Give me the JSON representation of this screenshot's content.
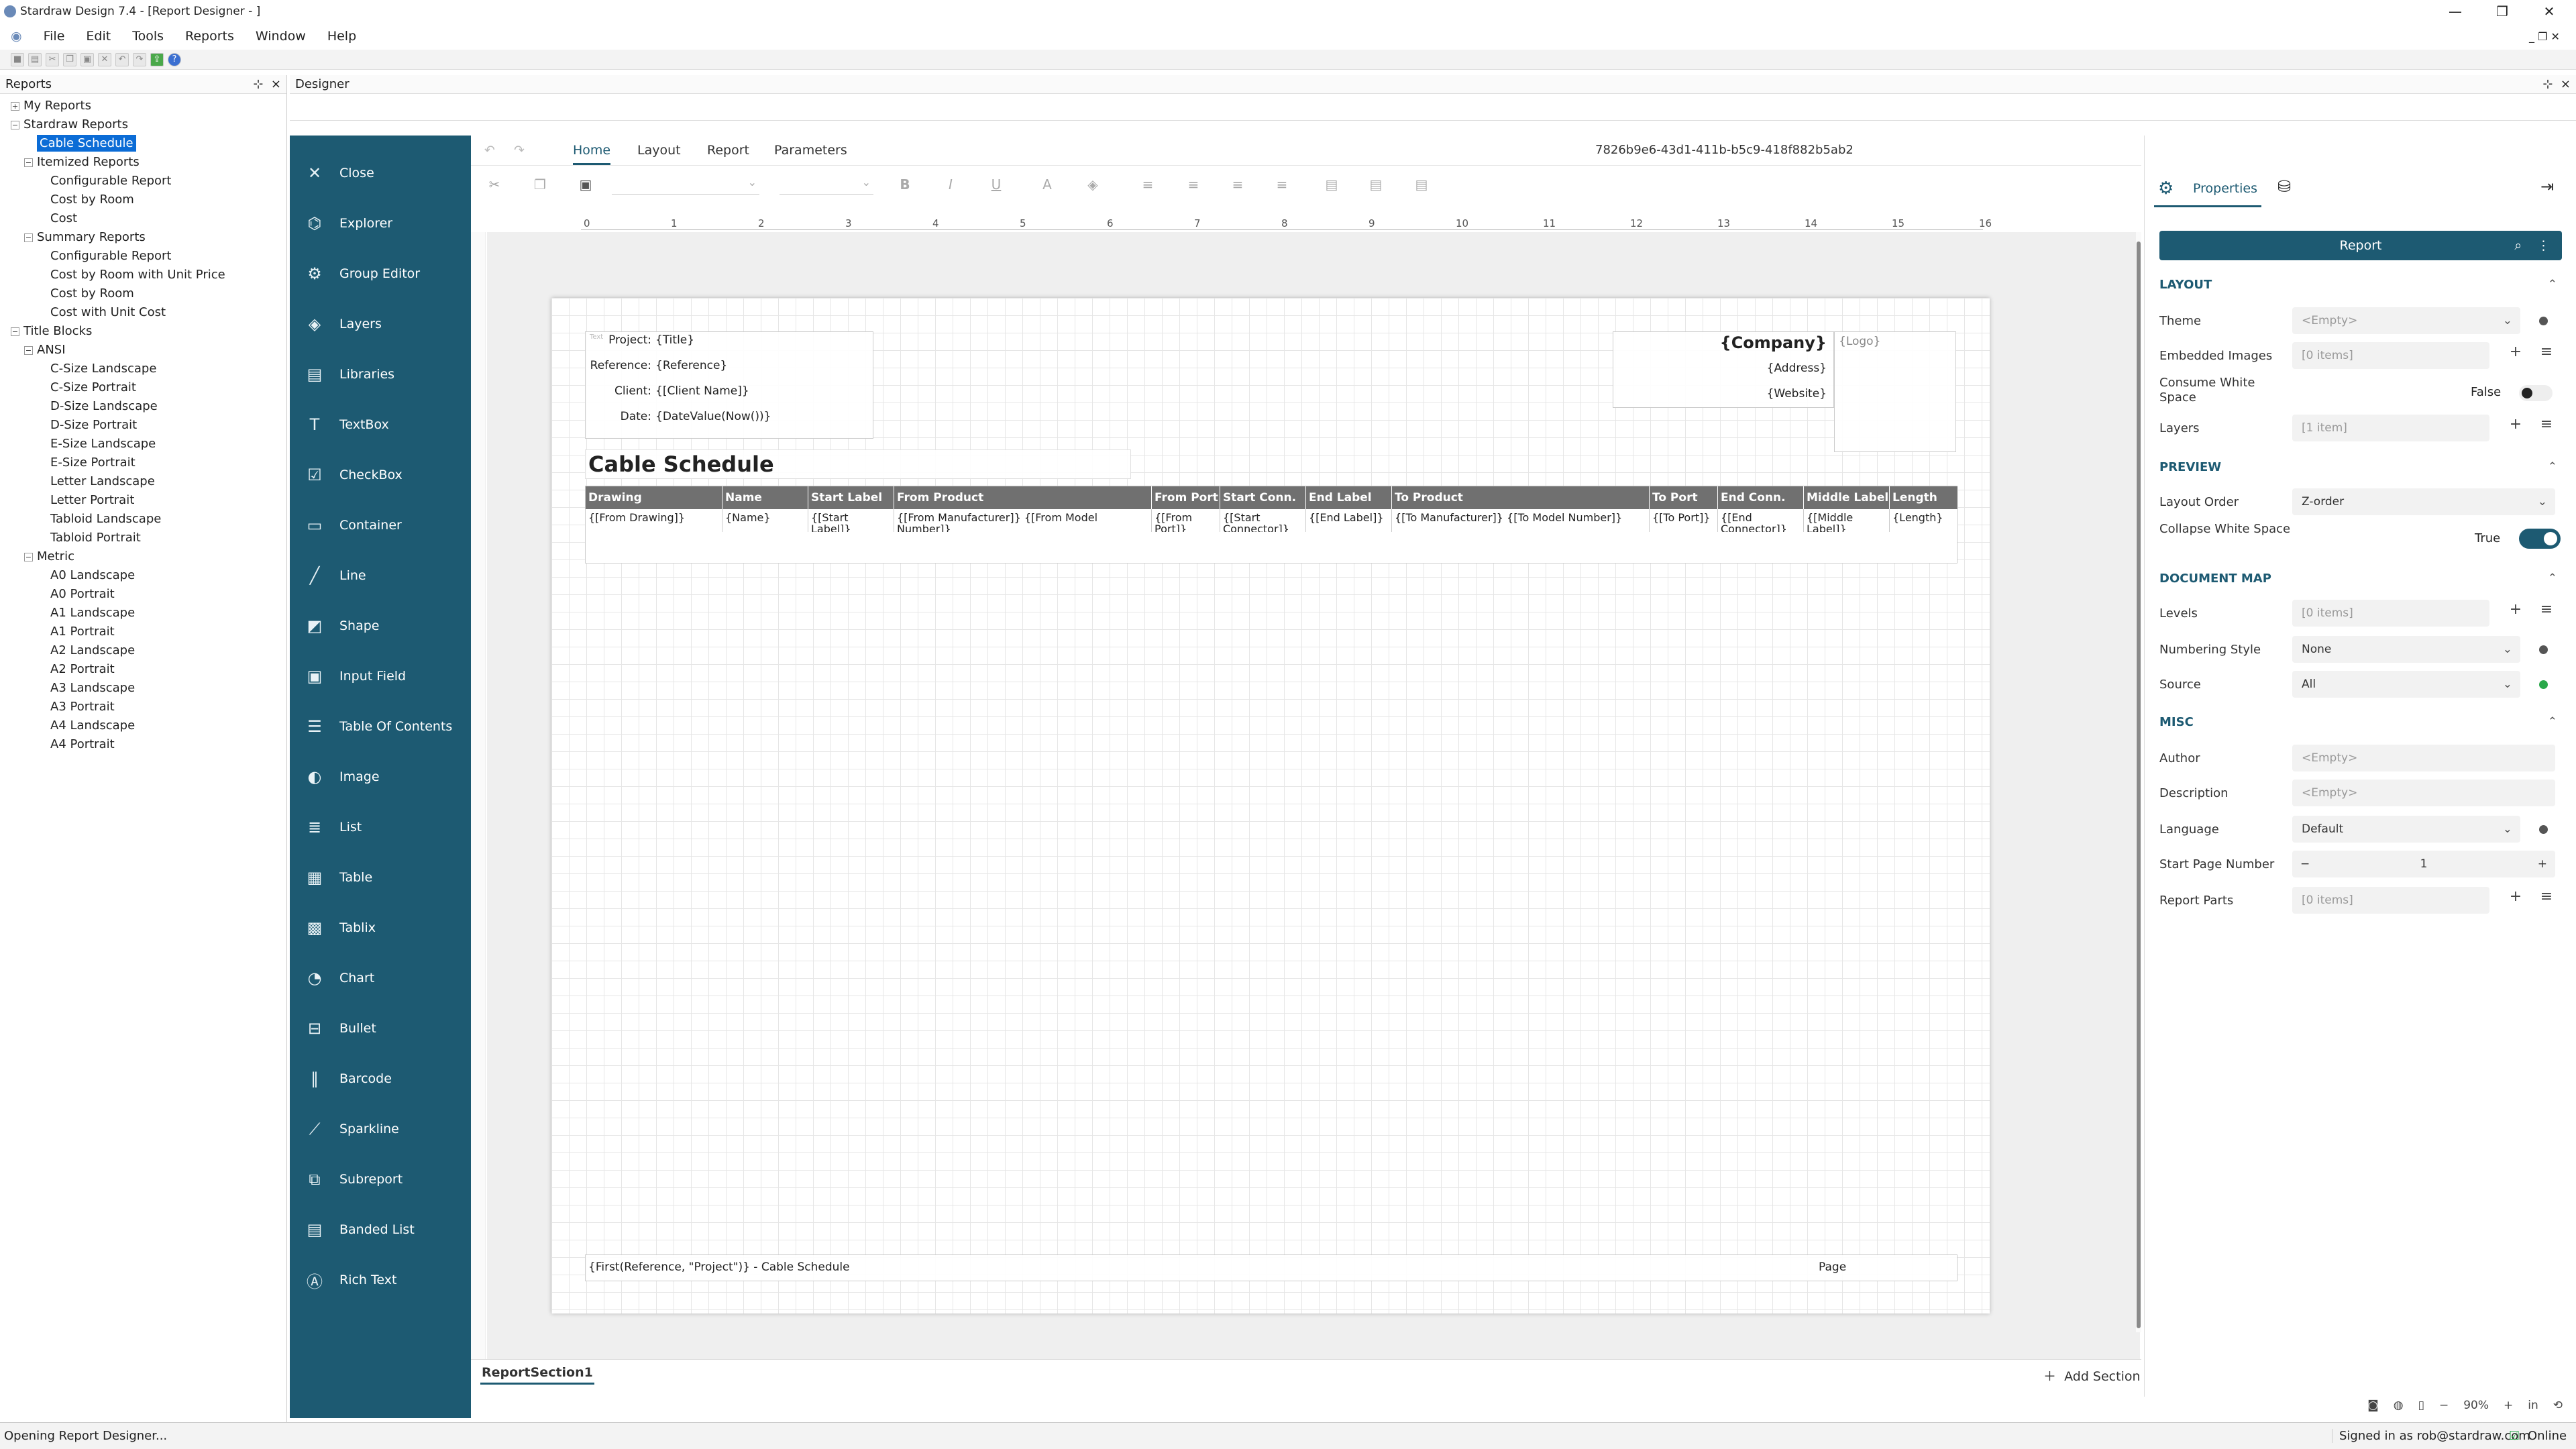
{
  "window": {
    "title": "Stardraw Design 7.4 - [Report Designer - ]"
  },
  "menu": [
    "File",
    "Edit",
    "Tools",
    "Reports",
    "Window",
    "Help"
  ],
  "reports_pane": {
    "title": "Reports",
    "pin": "⊹",
    "close": "×"
  },
  "tree": [
    {
      "label": "My Reports",
      "level": 0,
      "exp": "+"
    },
    {
      "label": "Stardraw Reports",
      "level": 0,
      "exp": "−"
    },
    {
      "label": "Cable Schedule",
      "level": 1,
      "selected": true
    },
    {
      "label": "Itemized Reports",
      "level": 1,
      "exp": "−"
    },
    {
      "label": "Configurable Report",
      "level": 2
    },
    {
      "label": "Cost by Room",
      "level": 2
    },
    {
      "label": "Cost",
      "level": 2
    },
    {
      "label": "Summary Reports",
      "level": 1,
      "exp": "−"
    },
    {
      "label": "Configurable Report",
      "level": 2
    },
    {
      "label": "Cost by Room with Unit Price",
      "level": 2
    },
    {
      "label": "Cost by Room",
      "level": 2
    },
    {
      "label": "Cost with Unit Cost",
      "level": 2
    },
    {
      "label": "Title Blocks",
      "level": 0,
      "exp": "−"
    },
    {
      "label": "ANSI",
      "level": 1,
      "exp": "−"
    },
    {
      "label": "C-Size Landscape",
      "level": 2
    },
    {
      "label": "C-Size Portrait",
      "level": 2
    },
    {
      "label": "D-Size Landscape",
      "level": 2
    },
    {
      "label": "D-Size Portrait",
      "level": 2
    },
    {
      "label": "E-Size Landscape",
      "level": 2
    },
    {
      "label": "E-Size Portrait",
      "level": 2
    },
    {
      "label": "Letter Landscape",
      "level": 2
    },
    {
      "label": "Letter Portrait",
      "level": 2
    },
    {
      "label": "Tabloid Landscape",
      "level": 2
    },
    {
      "label": "Tabloid Portrait",
      "level": 2
    },
    {
      "label": "Metric",
      "level": 1,
      "exp": "−"
    },
    {
      "label": "A0 Landscape",
      "level": 2
    },
    {
      "label": "A0 Portrait",
      "level": 2
    },
    {
      "label": "A1 Landscape",
      "level": 2
    },
    {
      "label": "A1 Portrait",
      "level": 2
    },
    {
      "label": "A2 Landscape",
      "level": 2
    },
    {
      "label": "A2 Portrait",
      "level": 2
    },
    {
      "label": "A3 Landscape",
      "level": 2
    },
    {
      "label": "A3 Portrait",
      "level": 2
    },
    {
      "label": "A4 Landscape",
      "level": 2
    },
    {
      "label": "A4 Portrait",
      "level": 2
    }
  ],
  "designer": {
    "title": "Designer"
  },
  "sidebar": [
    {
      "label": "Close",
      "icon": "close-icon",
      "glyph": "✕"
    },
    {
      "label": "Explorer",
      "icon": "explorer-icon",
      "glyph": "⌬"
    },
    {
      "label": "Group Editor",
      "icon": "group-editor-icon",
      "glyph": "⚙"
    },
    {
      "label": "Layers",
      "icon": "layers-icon",
      "glyph": "◈"
    },
    {
      "label": "Libraries",
      "icon": "libraries-icon",
      "glyph": "▤"
    },
    {
      "label": "TextBox",
      "icon": "textbox-icon",
      "glyph": "T"
    },
    {
      "label": "CheckBox",
      "icon": "checkbox-icon",
      "glyph": "☑"
    },
    {
      "label": "Container",
      "icon": "container-icon",
      "glyph": "▭"
    },
    {
      "label": "Line",
      "icon": "line-icon",
      "glyph": "╱"
    },
    {
      "label": "Shape",
      "icon": "shape-icon",
      "glyph": "◩"
    },
    {
      "label": "Input Field",
      "icon": "input-field-icon",
      "glyph": "▣"
    },
    {
      "label": "Table Of Contents",
      "icon": "table-of-contents-icon",
      "glyph": "☰"
    },
    {
      "label": "Image",
      "icon": "image-icon",
      "glyph": "◐"
    },
    {
      "label": "List",
      "icon": "list-icon",
      "glyph": "≣"
    },
    {
      "label": "Table",
      "icon": "table-icon",
      "glyph": "▦"
    },
    {
      "label": "Tablix",
      "icon": "tablix-icon",
      "glyph": "▩"
    },
    {
      "label": "Chart",
      "icon": "chart-icon",
      "glyph": "◔"
    },
    {
      "label": "Bullet",
      "icon": "bullet-icon",
      "glyph": "⊟"
    },
    {
      "label": "Barcode",
      "icon": "barcode-icon",
      "glyph": "∥"
    },
    {
      "label": "Sparkline",
      "icon": "sparkline-icon",
      "glyph": "⟋"
    },
    {
      "label": "Subreport",
      "icon": "subreport-icon",
      "glyph": "⧉"
    },
    {
      "label": "Banded List",
      "icon": "banded-list-icon",
      "glyph": "▤"
    },
    {
      "label": "Rich Text",
      "icon": "rich-text-icon",
      "glyph": "Ⓐ"
    }
  ],
  "ribbon": {
    "tabs": [
      "Home",
      "Layout",
      "Report",
      "Parameters"
    ],
    "active": "Home",
    "doc_id": "7826b9e6-43d1-411b-b5c9-418f882b5ab2"
  },
  "ruler": [
    "0",
    "1",
    "2",
    "3",
    "4",
    "5",
    "6",
    "7",
    "8",
    "9",
    "10",
    "11",
    "12",
    "13",
    "14",
    "15",
    "16"
  ],
  "report": {
    "project_label": "Project:",
    "project_val": "{Title}",
    "reference_label": "Reference:",
    "reference_val": "{Reference}",
    "client_label": "Client:",
    "client_val": "{[Client Name]}",
    "date_label": "Date:",
    "date_val": "{DateValue(Now())}",
    "company": "{Company}",
    "logo": "{Logo}",
    "address": "{Address}",
    "website": "{Website}",
    "heading": "Cable Schedule",
    "columns": [
      "Drawing",
      "Name",
      "Start Label",
      "From Product",
      "From Port",
      "Start Conn.",
      "End Label",
      "To Product",
      "To Port",
      "End Conn.",
      "Middle Label",
      "Length"
    ],
    "cells": [
      "{[From Drawing]}",
      "{Name}",
      "{[Start Label]}",
      "{[From Manufacturer]} {[From Model Number]}",
      "{[From Port]}",
      "{[Start Connector]}",
      "{[End Label]}",
      "{[To Manufacturer]} {[To Model Number]}",
      "{[To Port]}",
      "{[End Connector]}",
      "{[Middle Label]}",
      "{Length}"
    ],
    "footer_left": "{First(Reference, \"Project\")} - Cable Schedule",
    "footer_right": "Page"
  },
  "section": {
    "tab": "ReportSection1",
    "add": "Add Section"
  },
  "props": {
    "tab_properties": "Properties",
    "object": "Report",
    "sections": {
      "layout": "LAYOUT",
      "preview": "PREVIEW",
      "docmap": "DOCUMENT MAP",
      "misc": "MISC"
    },
    "theme": {
      "label": "Theme",
      "value": "<Empty>"
    },
    "embedded_images": {
      "label": "Embedded Images",
      "value": "[0 items]"
    },
    "consume_ws": {
      "label": "Consume White Space",
      "value": "False"
    },
    "layers": {
      "label": "Layers",
      "value": "[1 item]"
    },
    "layout_order": {
      "label": "Layout Order",
      "value": "Z-order"
    },
    "collapse_ws": {
      "label": "Collapse White Space",
      "value": "True"
    },
    "levels": {
      "label": "Levels",
      "value": "[0 items]"
    },
    "numbering": {
      "label": "Numbering Style",
      "value": "None"
    },
    "source": {
      "label": "Source",
      "value": "All"
    },
    "author": {
      "label": "Author",
      "value": "<Empty>"
    },
    "description": {
      "label": "Description",
      "value": "<Empty>"
    },
    "language": {
      "label": "Language",
      "value": "Default"
    },
    "start_page": {
      "label": "Start Page Number",
      "value": "1"
    },
    "report_parts": {
      "label": "Report Parts",
      "value": "[0 items]"
    }
  },
  "zoom": {
    "value": "90%",
    "unit": "in"
  },
  "status": {
    "left": "Opening Report Designer...",
    "user": "Signed in as rob@stardraw.com",
    "online": "Online"
  },
  "colors": {
    "sidebar": "#1d5a72",
    "accent": "#0b6cd6",
    "header_row": "#707070",
    "online": "#2aa84a"
  }
}
